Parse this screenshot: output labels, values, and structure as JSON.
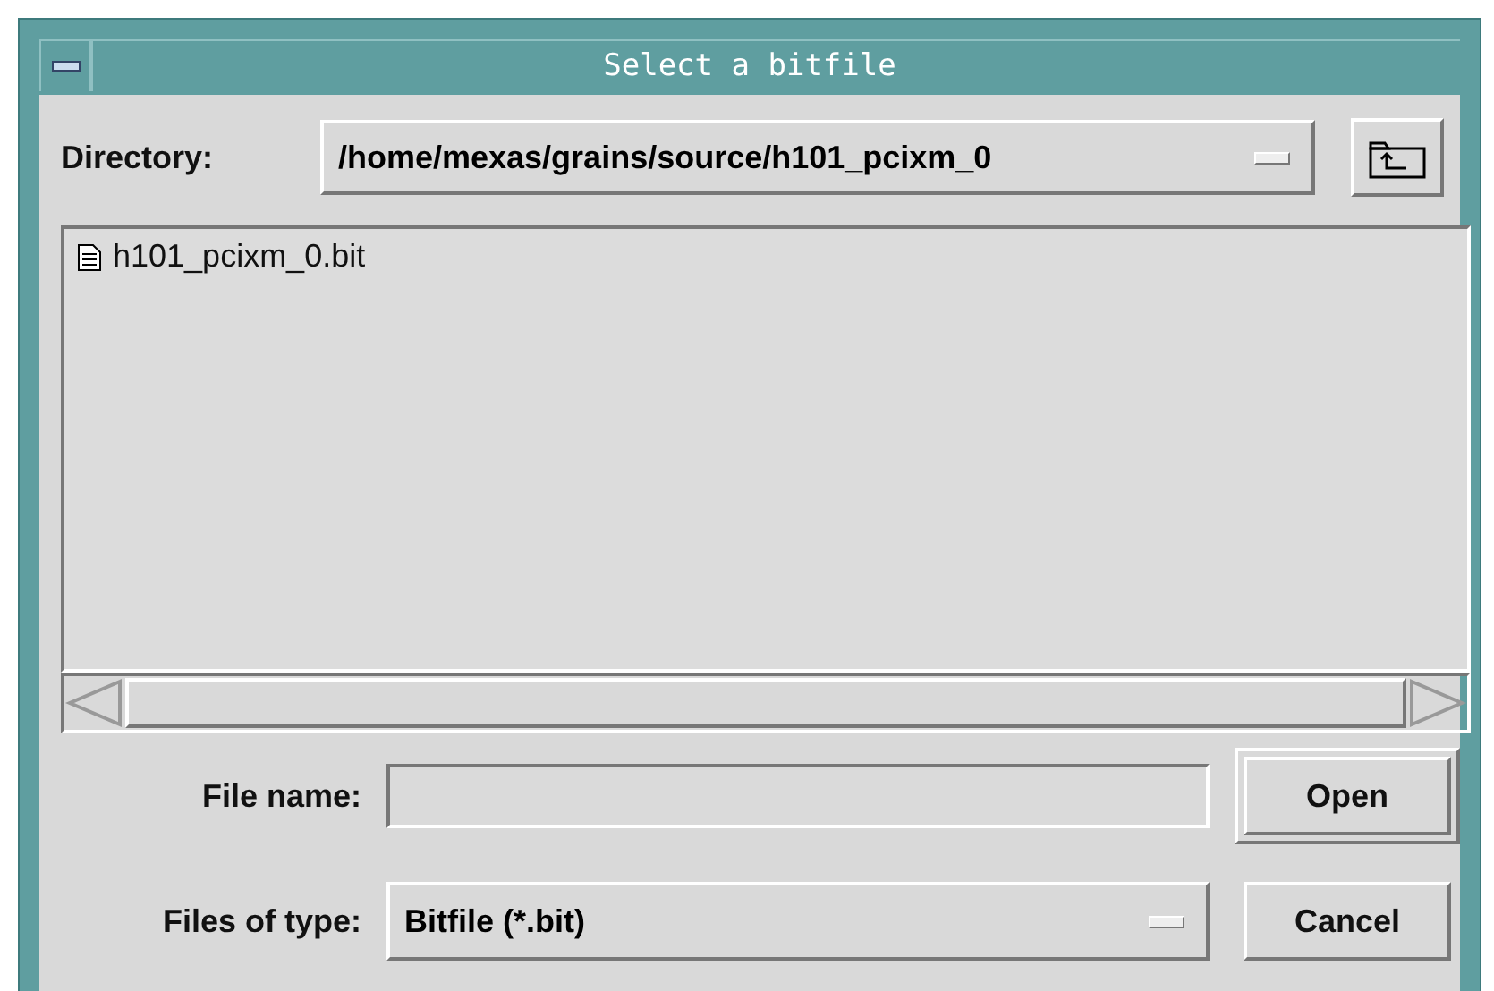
{
  "window": {
    "title": "Select a bitfile"
  },
  "directory": {
    "label": "Directory:",
    "value": "/home/mexas/grains/source/h101_pcixm_0"
  },
  "files": [
    {
      "name": "h101_pcixm_0.bit",
      "selected": false
    }
  ],
  "file_name": {
    "label": "File name:"
  },
  "files_of_type": {
    "label": "Files of type:",
    "value": "Bitfile (*.bit)"
  },
  "buttons": [
    {
      "label": "Open",
      "default": true
    },
    {
      "label": "Cancel",
      "default": false
    }
  ]
}
